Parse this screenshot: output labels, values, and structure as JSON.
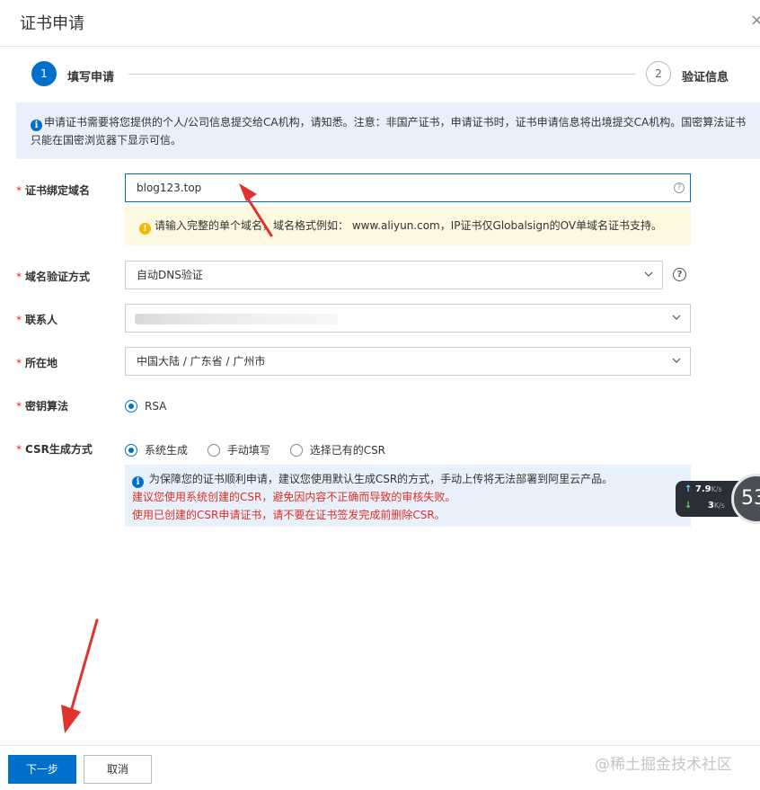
{
  "dialog": {
    "title": "证书申请",
    "close_glyph": "×"
  },
  "steps": [
    {
      "number": "1",
      "label": "填写申请",
      "active": true
    },
    {
      "number": "2",
      "label": "验证信息",
      "active": false
    }
  ],
  "notice": {
    "icon": "info-icon",
    "text": "申请证书需要将您提供的个人/公司信息提交给CA机构，请知悉。注意：非国产证书，申请证书时，证书申请信息将出境提交CA机构。国密算法证书只能在国密浏览器下显示可信。"
  },
  "form": {
    "domain": {
      "label": "证书绑定域名",
      "value": "blog123.top"
    },
    "domain_warning": {
      "icon": "warning-icon",
      "text": "请输入完整的单个域名，域名格式例如： www.aliyun.com，IP证书仅Globalsign的OV单域名证书支持。"
    },
    "verify_method": {
      "label": "域名验证方式",
      "value": "自动DNS验证"
    },
    "contact": {
      "label": "联系人",
      "value": ""
    },
    "location": {
      "label": "所在地",
      "value": "中国大陆 / 广东省 / 广州市"
    },
    "key_algorithm": {
      "label": "密钥算法",
      "options": [
        "RSA"
      ],
      "selected": "RSA"
    },
    "csr_method": {
      "label": "CSR生成方式",
      "options": [
        "系统生成",
        "手动填写",
        "选择已有的CSR"
      ],
      "selected": "系统生成"
    },
    "csr_info": {
      "line1": "为保障您的证书顺利申请，建议您使用默认生成CSR的方式，手动上传将无法部署到阿里云产品。",
      "line2": "建议您使用系统创建的CSR，避免因内容不正确而导致的审核失败。",
      "line3": "使用已创建的CSR申请证书，请不要在证书签发完成前删除CSR。"
    },
    "required_mark": "*",
    "help_glyph": "?"
  },
  "speed_widget": {
    "up": "7.9",
    "up_unit": "K/s",
    "down": "3",
    "down_unit": "K/s",
    "gauge": "53"
  },
  "footer": {
    "next_label": "下一步",
    "cancel_label": "取消"
  },
  "watermark": "@稀土掘金技术社区",
  "colors": {
    "primary": "#0070cc",
    "danger": "#d93026",
    "warning": "#f5b800",
    "notice_bg": "#e8f1fb",
    "warning_bg": "#fdf8e0"
  }
}
